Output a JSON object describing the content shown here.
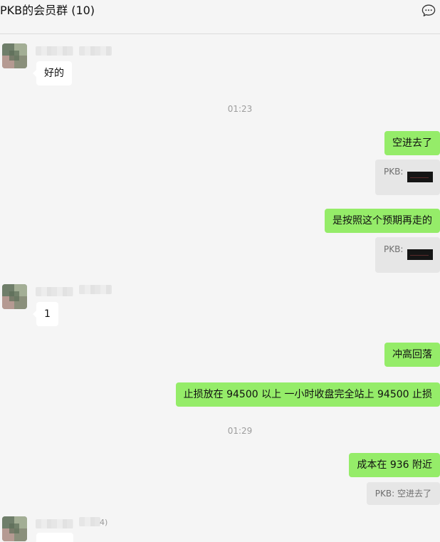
{
  "header": {
    "title": "PKB的会员群 (10)",
    "more_icon": "chat-bubble-dots-icon"
  },
  "messages": {
    "m1": {
      "text": "好的"
    },
    "t1": {
      "text": "01:23"
    },
    "m2": {
      "text": "空进去了"
    },
    "q1": {
      "text": "PKB:"
    },
    "m3": {
      "text": "是按照这个预期再走的"
    },
    "q2": {
      "text": "PKB:"
    },
    "m4": {
      "text": "1"
    },
    "m5": {
      "text": "冲高回落"
    },
    "m6": {
      "text": "止损放在 94500 以上 一小时收盘完全站上 94500 止损"
    },
    "t2": {
      "text": "01:29"
    },
    "m7": {
      "text": "成本在 936 附近"
    },
    "q3": {
      "text": "PKB: 空进去了"
    },
    "nick3_tail": {
      "text": "4)"
    }
  },
  "colors": {
    "outgoing_bubble": "#95ec69",
    "incoming_bubble": "#ffffff",
    "background": "#f5f5f5",
    "quote_bg": "#e6e6e6"
  }
}
